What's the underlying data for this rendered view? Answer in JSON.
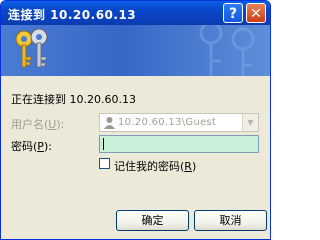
{
  "titlebar": {
    "title": "连接到 10.20.60.13",
    "help_label": "?",
    "close_label": "✕"
  },
  "connecting_text": "正在连接到 10.20.60.13",
  "username": {
    "label_prefix": "用户名(",
    "label_key": "U",
    "label_suffix": "):",
    "value": "10.20.60.13\\Guest"
  },
  "password": {
    "label_prefix": "密码(",
    "label_key": "P",
    "label_suffix": "):",
    "value": ""
  },
  "remember": {
    "label_prefix": "记住我的密码(",
    "label_key": "R",
    "label_suffix": ")",
    "checked": false
  },
  "buttons": {
    "ok": "确定",
    "cancel": "取消"
  },
  "colors": {
    "title_bar": "#0a3fbb",
    "banner": "#3767c8",
    "dialog_bg": "#ece9d8",
    "password_field": "#c9f0d8"
  },
  "icons": [
    "keys-icon",
    "user-icon",
    "help-icon",
    "close-icon",
    "chevron-down-icon"
  ]
}
